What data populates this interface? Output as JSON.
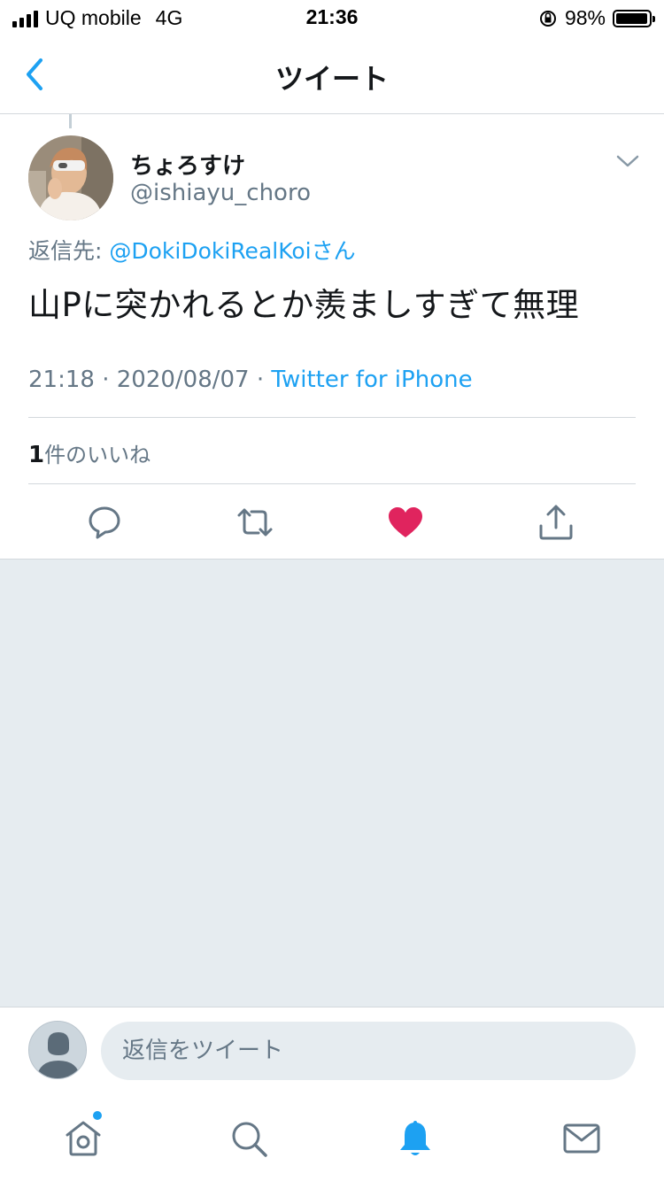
{
  "status": {
    "carrier": "UQ mobile",
    "network": "4G",
    "time": "21:36",
    "battery": "98%",
    "battery_level": 0.98
  },
  "nav": {
    "title": "ツイート"
  },
  "tweet": {
    "display_name": "ちょろすけ",
    "handle": "@ishiayu_choro",
    "reply_prefix": "返信先: ",
    "reply_target": "@DokiDokiRealKoi",
    "reply_suffix": "さん",
    "text": "山Pに突かれるとか羨ましすぎて無理",
    "time": "21:18",
    "date": "2020/08/07",
    "separator": " · ",
    "source": "Twitter for iPhone",
    "like_count": "1",
    "like_label": "件のいいね"
  },
  "actions": {
    "reply": "reply-icon",
    "retweet": "retweet-icon",
    "like": "heart-icon",
    "share": "share-icon",
    "like_color": "#e0245e"
  },
  "reply_bar": {
    "placeholder": "返信をツイート"
  },
  "tabbar": {
    "home": "home-icon",
    "search": "search-icon",
    "notifications": "bell-icon",
    "messages": "mail-icon",
    "active_color": "#1da1f2"
  },
  "colors": {
    "accent": "#1da1f2",
    "secondary_text": "#657786",
    "background_gray": "#e6ecf0"
  }
}
